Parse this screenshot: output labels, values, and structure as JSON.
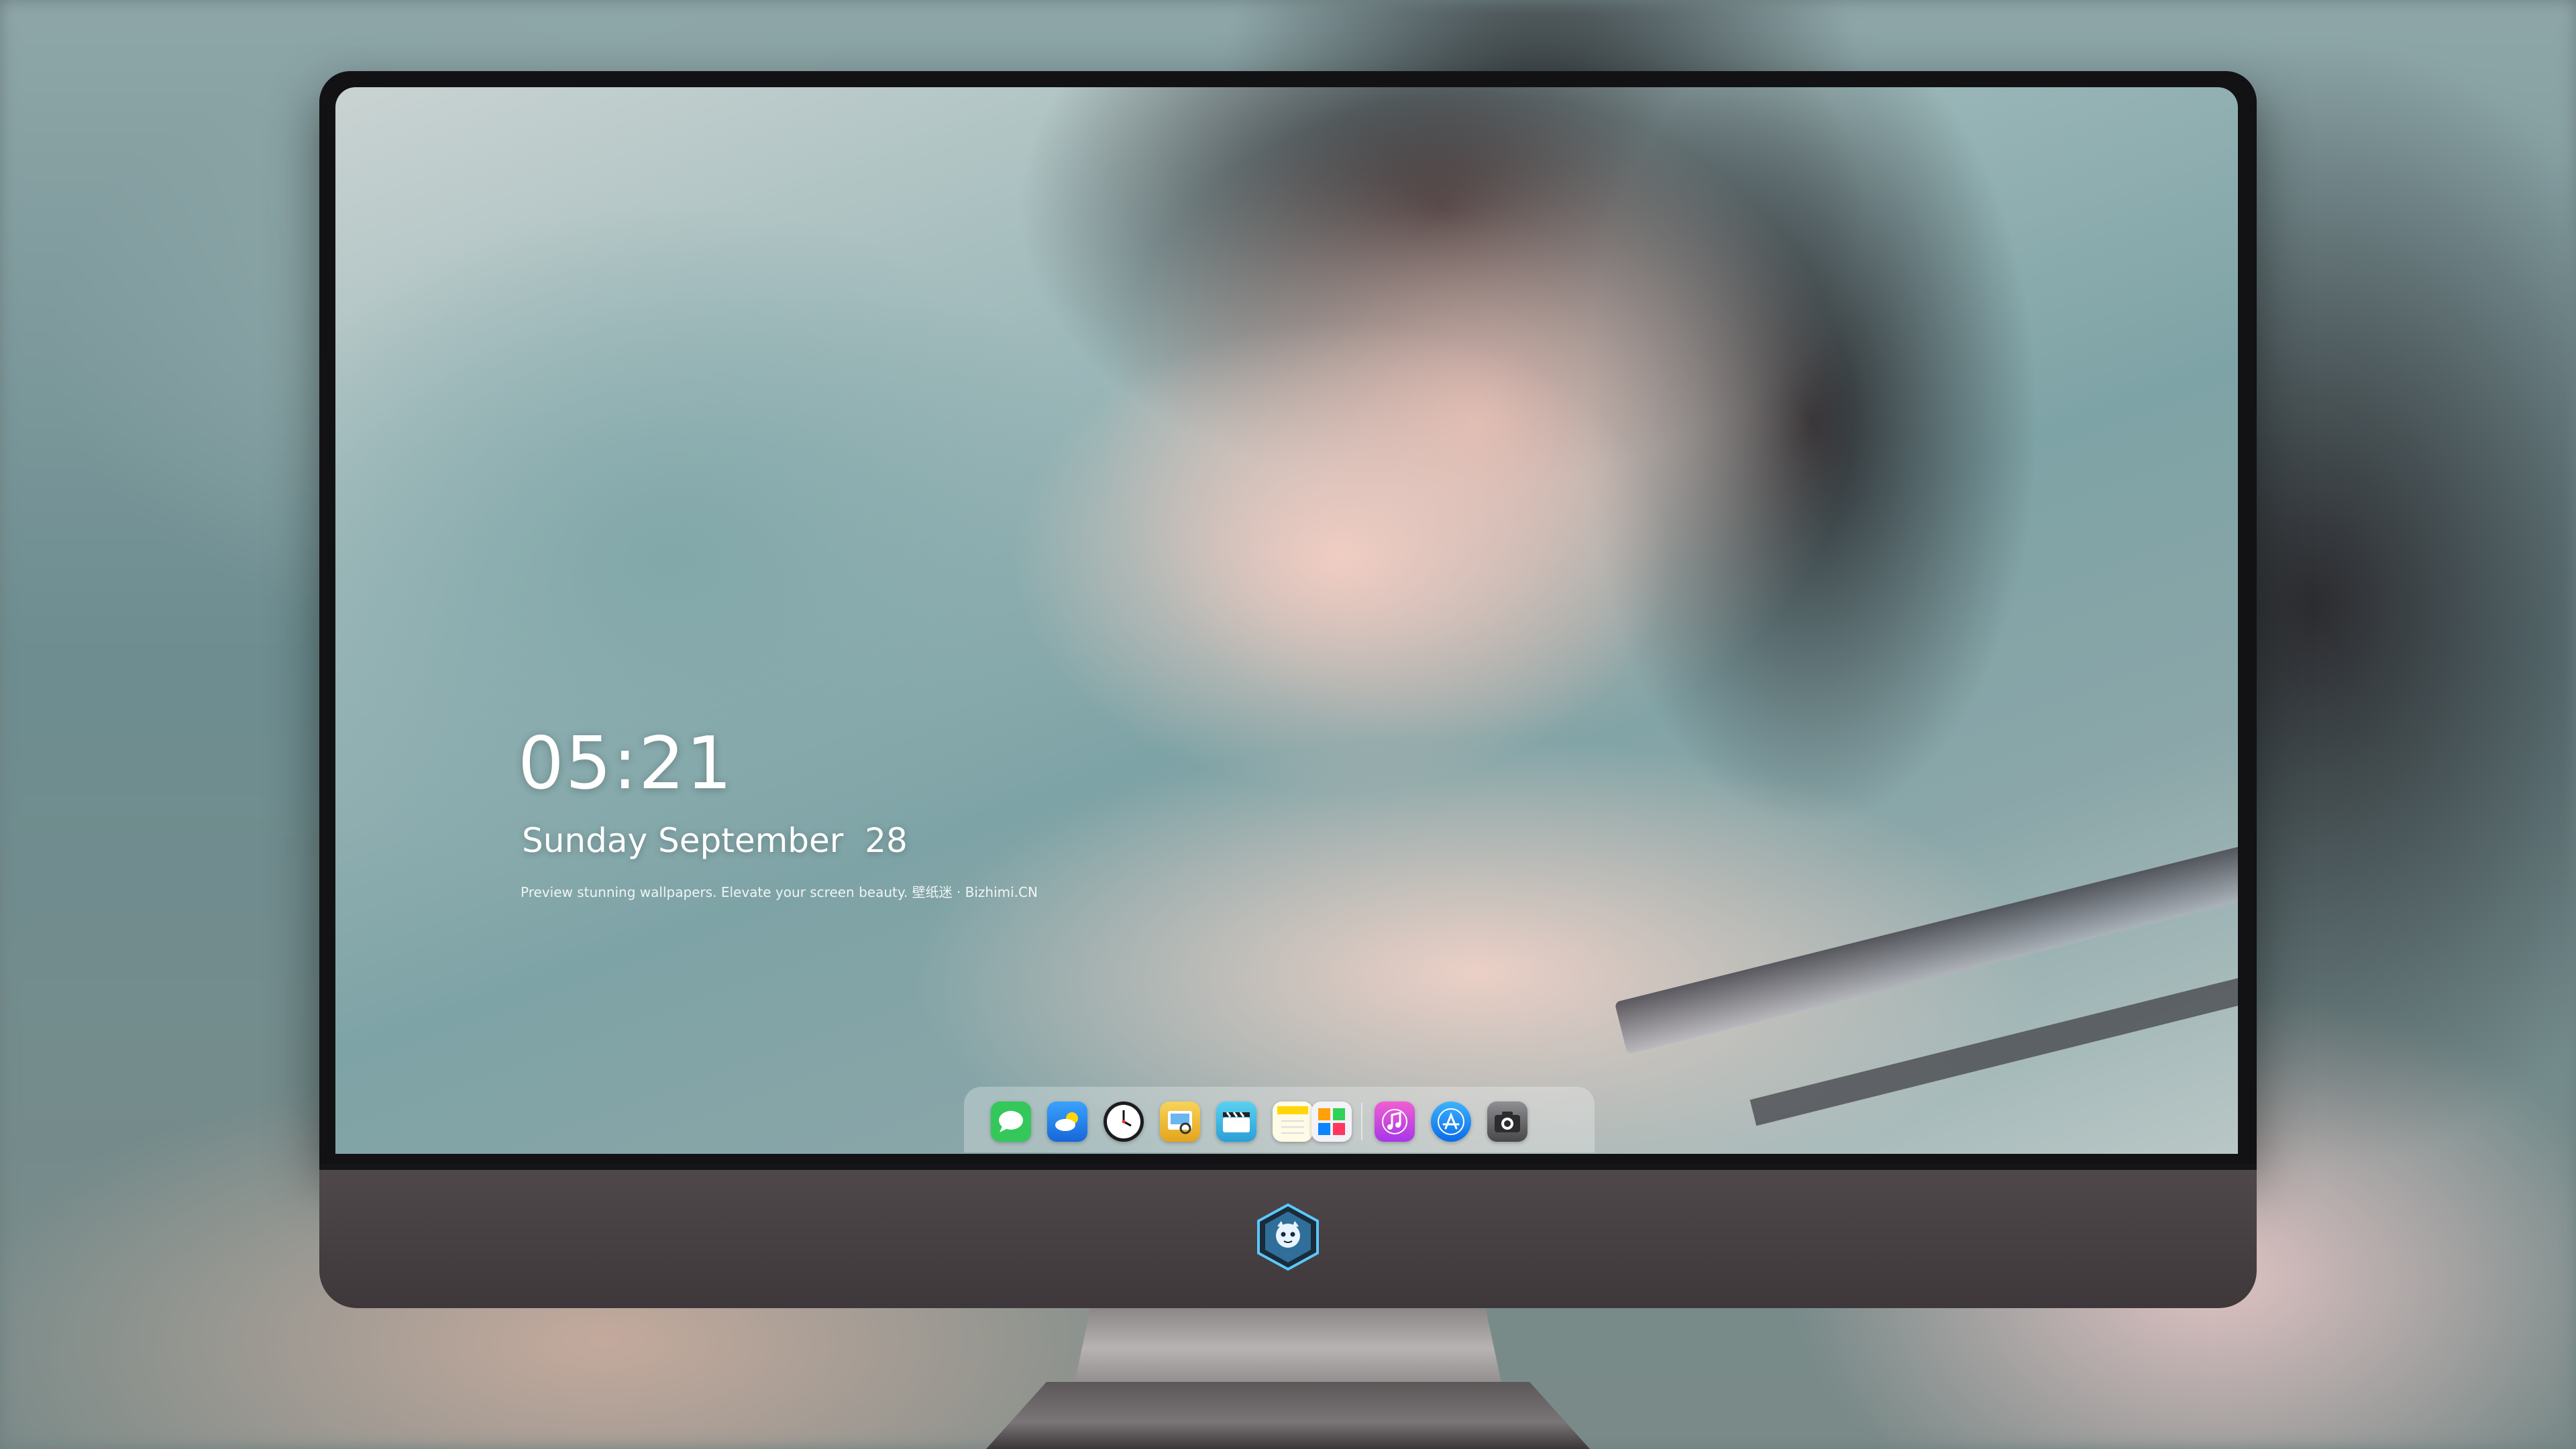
{
  "lock_screen": {
    "time": "05:21",
    "date": "Sunday September  28",
    "tagline": "Preview stunning wallpapers. Elevate your screen beauty. 壁纸迷 · Bizhimi.CN"
  },
  "dock": {
    "apps": [
      {
        "name": "messages-icon",
        "color": "#34c759"
      },
      {
        "name": "weather-icon",
        "color": "#1e90ff"
      },
      {
        "name": "clock-icon",
        "color": "#1c1c1e"
      },
      {
        "name": "preview-icon",
        "color": "#f5c542"
      },
      {
        "name": "video-icon",
        "color": "#3fb8e6"
      },
      {
        "name": "notes-icon",
        "color": "#ffd60a"
      },
      {
        "name": "photos-icon",
        "color": "#e9e9ef"
      },
      {
        "name": "music-icon",
        "color": "#c645f0"
      },
      {
        "name": "app-store-icon",
        "color": "#0a84ff"
      },
      {
        "name": "camera-icon",
        "color": "#6e6e73"
      }
    ]
  },
  "colors": {
    "bezel": "#121214",
    "chin": "#4a4447",
    "text": "#ffffff"
  }
}
